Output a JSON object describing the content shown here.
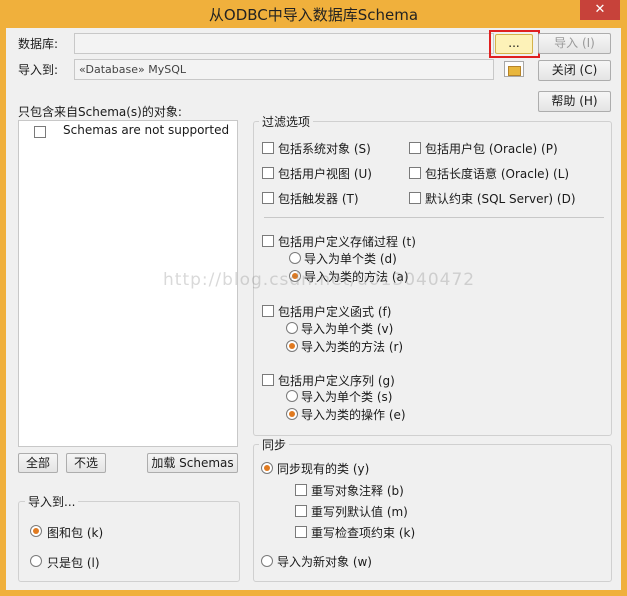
{
  "window": {
    "title": "从ODBC中导入数据库Schema",
    "close_icon": "✕"
  },
  "database": {
    "label": "数据库:",
    "value": "",
    "browse_label": "..."
  },
  "import_to": {
    "label": "导入到:",
    "value": "«Database» MySQL"
  },
  "buttons": {
    "import": "导入 (I)",
    "close": "关闭 (C)",
    "help": "帮助 (H)"
  },
  "schemas": {
    "label": "只包含来自Schema(s)的对象:",
    "items": [
      "Schemas are not supported"
    ],
    "all": "全部",
    "none": "不选",
    "load": "加载 Schemas"
  },
  "filter": {
    "title": "过滤选项",
    "options": [
      "包括系统对象 (S)",
      "包括用户包 (Oracle) (P)",
      "包括用户视图 (U)",
      "包括长度语意 (Oracle) (L)",
      "包括触发器 (T)",
      "默认约束 (SQL Server) (D)"
    ],
    "stored_procs": {
      "label": "包括用户定义存储过程 (t)",
      "radio1": "导入为单个类 (d)",
      "radio2": "导入为类的方法 (a)",
      "selected": 2
    },
    "functions": {
      "label": "包括用户定义函式 (f)",
      "radio1": "导入为单个类 (v)",
      "radio2": "导入为类的方法 (r)",
      "selected": 2
    },
    "sequences": {
      "label": "包括用户定义序列 (g)",
      "radio1": "导入为单个类 (s)",
      "radio2": "导入为类的操作 (e)",
      "selected": 2
    }
  },
  "import_to_group": {
    "title": "导入到...",
    "option1": "图和包 (k)",
    "option2": "只是包 (l)",
    "selected": 1
  },
  "sync": {
    "title": "同步",
    "sync_existing": "同步现有的类 (y)",
    "overwrite_notes": "重写对象注释 (b)",
    "overwrite_defaults": "重写列默认值 (m)",
    "overwrite_checks": "重写检查项约束 (k)",
    "import_new": "导入为新对象 (w)",
    "selected": 1
  },
  "watermark": "http://blog.csdn.net/u013040472"
}
